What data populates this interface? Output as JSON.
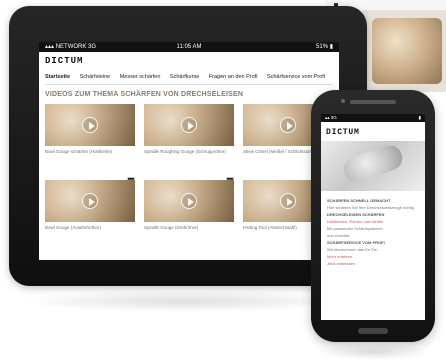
{
  "tablet": {
    "status_bar": {
      "left": "▴▴▴ NETWORK 3G",
      "center": "11:05 AM",
      "right": "51% ▮"
    },
    "logo": "DICTUM",
    "nav": [
      "Startseite",
      "Schärfsteine",
      "Messer schärfen",
      "Schärfkurse",
      "Fragen an den Profi",
      "Schärfservice vom Profi"
    ],
    "heading": "VIDEOS ZUM THEMA SCHÄRFEN VON DRECHSELEISEN",
    "videos": [
      {
        "caption": "Bowl Gouge schärfen (Hohlkehle)"
      },
      {
        "caption": "Spindle Roughing Gouge (Schruppröhre)"
      },
      {
        "caption": "Skew Chisel (Meißel / Schlichtstahl)"
      },
      {
        "caption": "Bowl Gouge (Ausdrehröhre)"
      },
      {
        "caption": "Spindle Gouge (Drehröhre)"
      },
      {
        "caption": "Parting Tool (Abstechstahl)"
      }
    ]
  },
  "phone": {
    "status_bar": {
      "left": "▴▴ 3G",
      "right": "▮"
    },
    "logo": "DICTUM",
    "lines": [
      "SCHÄRFEN SCHNELL GEMACHT",
      "Hier schärfen Sie Ihre Drechselwerkzeuge richtig.",
      "DRECHSELEISEN SCHÄRFEN",
      "Hohlkehlen, Röhren und Meißel",
      "Mit passenden Schärfsystemen",
      "und Zubehör.",
      "SCHÄRFSERVICE VOM PROFI",
      "Wir übernehmen das für Sie.",
      "Mehr erfahren",
      "Jetzt entdecken"
    ]
  }
}
